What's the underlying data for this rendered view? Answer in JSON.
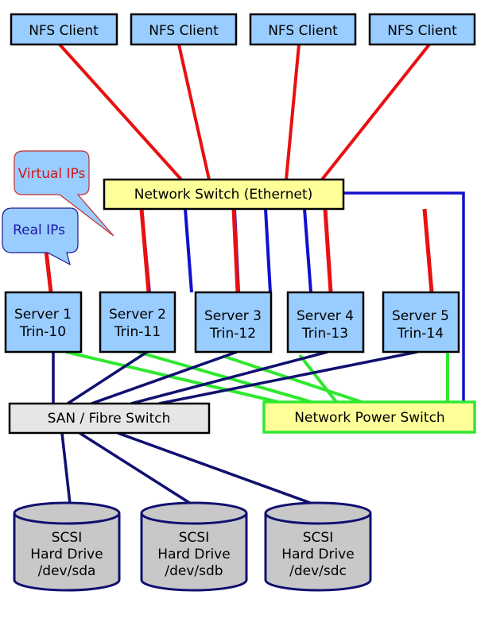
{
  "clients": [
    {
      "label": "NFS Client"
    },
    {
      "label": "NFS Client"
    },
    {
      "label": "NFS Client"
    },
    {
      "label": "NFS Client"
    }
  ],
  "network_switch": {
    "label": "Network Switch (Ethernet)"
  },
  "callouts": {
    "virtual": "Virtual IPs",
    "real": "Real IPs"
  },
  "servers": [
    {
      "name": "Server 1",
      "host": "Trin-10"
    },
    {
      "name": "Server 2",
      "host": "Trin-11"
    },
    {
      "name": "Server 3",
      "host": "Trin-12"
    },
    {
      "name": "Server 4",
      "host": "Trin-13"
    },
    {
      "name": "Server 5",
      "host": "Trin-14"
    }
  ],
  "san_switch": {
    "label": "SAN / Fibre Switch"
  },
  "power_switch": {
    "label": "Network Power Switch"
  },
  "drives": [
    {
      "l1": "SCSI",
      "l2": "Hard Drive",
      "l3": "/dev/sda"
    },
    {
      "l1": "SCSI",
      "l2": "Hard Drive",
      "l3": "/dev/sdb"
    },
    {
      "l1": "SCSI",
      "l2": "Hard Drive",
      "l3": "/dev/sdc"
    }
  ],
  "colors": {
    "virtual_ip": "#e81010",
    "real_ip": "#1010d0",
    "power": "#30e830",
    "fibre": "#101070",
    "box_blue": "#99ccff",
    "box_yellow": "#ffff99",
    "box_gray": "#e6e6e6",
    "drive_gray": "#c8c8c8"
  }
}
